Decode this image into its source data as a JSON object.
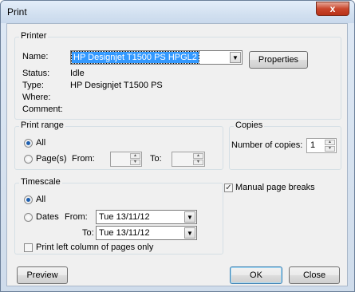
{
  "window": {
    "title": "Print",
    "close_glyph": "x"
  },
  "printer": {
    "group_label": "Printer",
    "name_label": "Name:",
    "name_value": "HP Designjet T1500 PS HPGL2",
    "properties_label": "Properties",
    "status_label": "Status:",
    "status_value": "Idle",
    "type_label": "Type:",
    "type_value": "HP Designjet T1500 PS",
    "where_label": "Where:",
    "comment_label": "Comment:"
  },
  "print_range": {
    "group_label": "Print range",
    "all_label": "All",
    "pages_label": "Page(s)",
    "from_label": "From:",
    "to_label": "To:",
    "selected": "all"
  },
  "copies": {
    "group_label": "Copies",
    "number_label": "Number of copies:",
    "number_value": "1"
  },
  "timescale": {
    "group_label": "Timescale",
    "all_label": "All",
    "dates_label": "Dates",
    "from_label": "From:",
    "from_value": "Tue 13/11/12",
    "to_label": "To:",
    "to_value": "Tue 13/11/12",
    "left_column_label": "Print left column of pages only",
    "left_column_checked": false,
    "selected": "all"
  },
  "manual_page_breaks": {
    "label": "Manual page breaks",
    "checked": true
  },
  "buttons": {
    "preview": "Preview",
    "ok": "OK",
    "close": "Close"
  },
  "icons": {
    "dropdown": "chevron-down-icon",
    "spin_up": "arrow-up-icon",
    "spin_down": "arrow-down-icon",
    "checkmark": "checkmark-icon"
  }
}
